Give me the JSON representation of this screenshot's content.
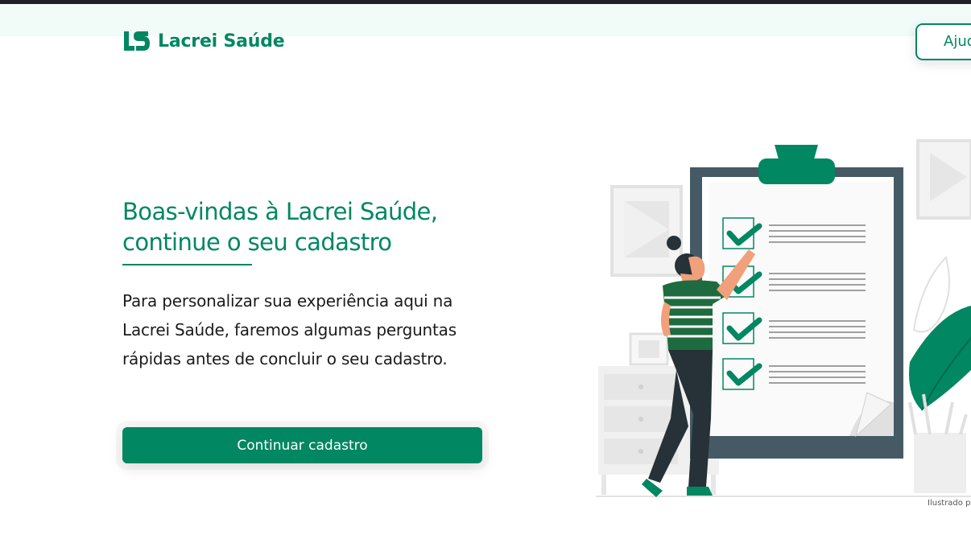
{
  "header": {
    "brand_name": "Lacrei Saúde",
    "help_label": "Ajuda"
  },
  "main": {
    "title": "Boas-vindas à Lacrei Saúde, continue o seu cadastro",
    "description": "Para personalizar sua experiência aqui na Lacrei Saúde, faremos algumas perguntas rápidas antes de concluir o seu cadastro.",
    "cta_label": "Continuar cadastro"
  },
  "illustration": {
    "icon": "clipboard-checklist-illustration",
    "credit": "Ilustrado por"
  },
  "colors": {
    "brand": "#018762",
    "text": "#1b1b1b",
    "header_band": "#f1fcf8"
  }
}
